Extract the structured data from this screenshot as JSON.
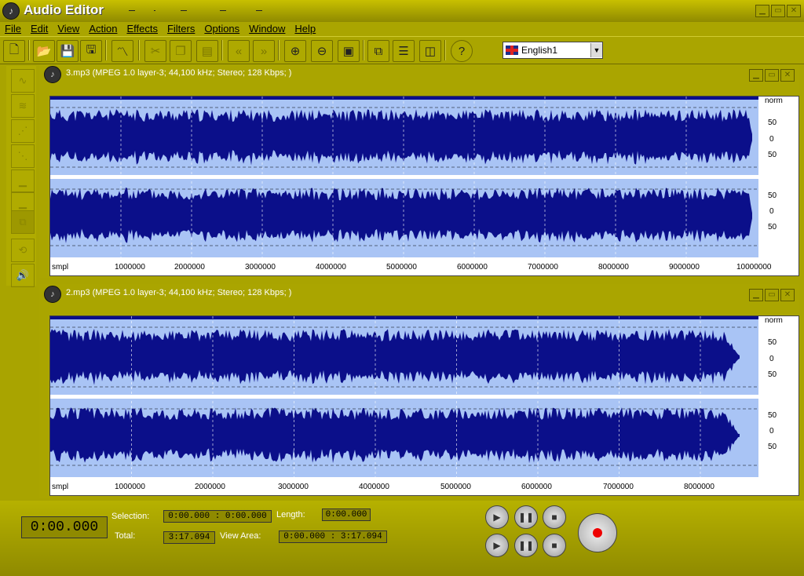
{
  "app": {
    "title": "Audio Editor"
  },
  "menu": [
    "File",
    "Edit",
    "View",
    "Action",
    "Effects",
    "Filters",
    "Options",
    "Window",
    "Help"
  ],
  "language": {
    "selected": "English1"
  },
  "tracks": [
    {
      "title": "3.mp3 (MPEG 1.0 layer-3; 44,100 kHz; Stereo; 128 Kbps; )",
      "scale_unit": "smpl",
      "norm_label": "norm",
      "ruler": [
        "1000000",
        "2000000",
        "3000000",
        "4000000",
        "5000000",
        "6000000",
        "7000000",
        "8000000",
        "9000000",
        "10000000"
      ],
      "vscale": [
        "50",
        "0",
        "50"
      ]
    },
    {
      "title": "2.mp3 (MPEG 1.0 layer-3; 44,100 kHz; Stereo; 128 Kbps; )",
      "scale_unit": "smpl",
      "norm_label": "norm",
      "ruler": [
        "1000000",
        "2000000",
        "3000000",
        "4000000",
        "5000000",
        "6000000",
        "7000000",
        "8000000"
      ],
      "vscale": [
        "50",
        "0",
        "50"
      ]
    }
  ],
  "status": {
    "current_time": "0:00.000",
    "selection_label": "Selection:",
    "selection_value": "0:00.000 : 0:00.000",
    "length_label": "Length:",
    "length_value": "0:00.000",
    "total_label": "Total:",
    "total_value": "3:17.094",
    "view_area_label": "View Area:",
    "view_area_value": "0:00.000 : 3:17.094"
  },
  "colors": {
    "accent": "#aaa500",
    "wave_bg": "#a9c4f5",
    "wave": "#0b0f8a"
  }
}
